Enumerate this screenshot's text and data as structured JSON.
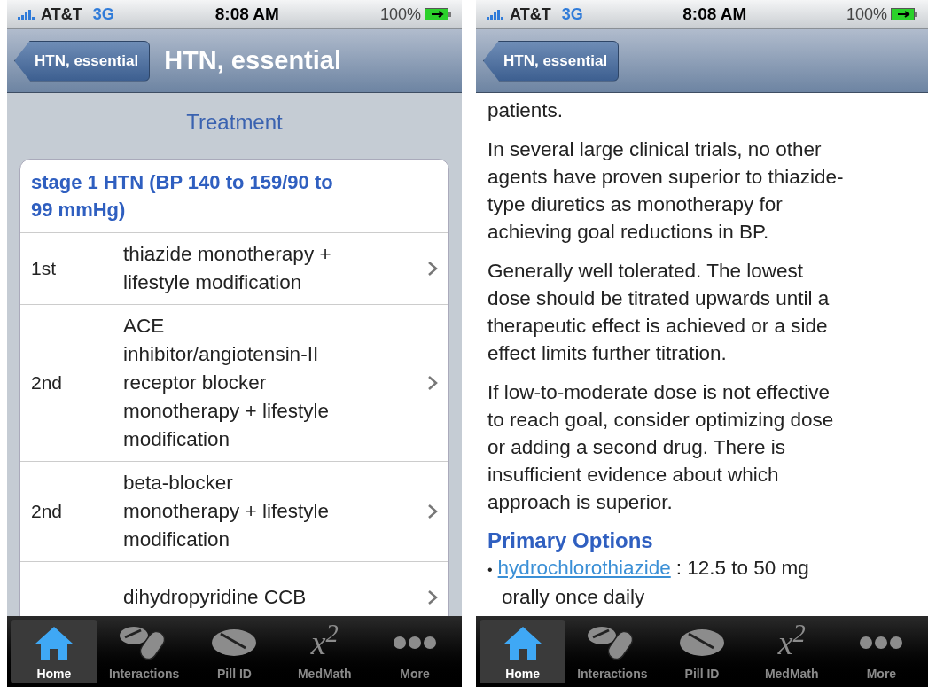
{
  "left_screen": {
    "status_bar": {
      "carrier": "AT&T",
      "network": "3G",
      "time": "8:08 AM",
      "battery": "100%"
    },
    "nav_bar": {
      "back_button": "HTN, essential",
      "title": "HTN, essential"
    },
    "section_header": "Treatment",
    "group": {
      "title_lines": [
        "stage 1 HTN (BP 140 to 159/90 to",
        "99 mmHg)"
      ],
      "rows": [
        {
          "rank": "1st",
          "lines": [
            "thiazide monotherapy +",
            "lifestyle modification"
          ]
        },
        {
          "rank": "2nd",
          "lines": [
            "ACE",
            "inhibitor/angiotensin-II",
            "receptor blocker",
            "monotherapy + lifestyle",
            "modification"
          ]
        },
        {
          "rank": "2nd",
          "lines": [
            "beta-blocker",
            "monotherapy + lifestyle",
            "modification"
          ]
        },
        {
          "lines": [
            "dihydropyridine CCB"
          ]
        }
      ]
    },
    "tab_bar": [
      {
        "kind": "home",
        "label": "Home",
        "selected": true
      },
      {
        "kind": "pills",
        "label": "Interactions",
        "selected": false
      },
      {
        "kind": "pill",
        "label": "Pill ID",
        "selected": false
      },
      {
        "kind": "formula",
        "glyph": "x$^{2}$",
        "label": "MedMath",
        "selected": false
      },
      {
        "kind": "more",
        "label": "More",
        "selected": false
      }
    ]
  },
  "right_screen": {
    "status_bar": {
      "carrier": "AT&T",
      "network": "3G",
      "time": "8:08 AM",
      "battery": "100%"
    },
    "nav_bar": {
      "back_button": "HTN, essential"
    },
    "paragraphs": [
      [
        "patients."
      ],
      [
        "In several large clinical trials, no other",
        "agents have proven superior to thiazide-",
        "type diuretics as monotherapy for",
        "achieving goal reductions in BP."
      ],
      [
        "Generally well tolerated. The lowest",
        "dose should be titrated upwards until a",
        "therapeutic effect is achieved or a side",
        "effect limits further titration."
      ],
      [
        "If low-to-moderate dose is not effective",
        "to reach goal, consider optimizing dose",
        "or adding a second drug. There is",
        "insufficient evidence about which",
        "approach is superior."
      ]
    ],
    "options_heading": "Primary Options",
    "options": [
      {
        "bullet": "•",
        "link": "hydrochlorothiazide",
        "text_lines": [
          ": 12.5 to 50 mg",
          "orally once daily"
        ]
      }
    ],
    "tab_bar": [
      {
        "kind": "home",
        "label": "Home",
        "selected": true
      },
      {
        "kind": "pills",
        "label": "Interactions",
        "selected": false
      },
      {
        "kind": "pill",
        "label": "Pill ID",
        "selected": false
      },
      {
        "kind": "formula",
        "glyph": "x$^{2}$",
        "label": "MedMath",
        "selected": false
      },
      {
        "kind": "more",
        "label": "More",
        "selected": false
      }
    ]
  }
}
